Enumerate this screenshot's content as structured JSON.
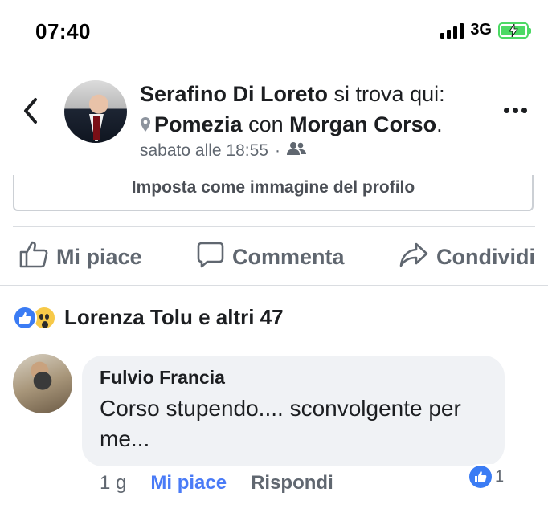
{
  "status_bar": {
    "time": "07:40",
    "network": "3G"
  },
  "post_header": {
    "author": "Serafino Di Loreto",
    "checkin_text": "si trova qui:",
    "place": "Pomezia",
    "with_text": "con",
    "tagged": "Morgan Corso",
    "period": ".",
    "timestamp": "sabato alle 18:55",
    "separator": "·"
  },
  "profile_button": {
    "label": "Imposta come immagine del profilo"
  },
  "actions": {
    "like": "Mi piace",
    "comment": "Commenta",
    "share": "Condividi"
  },
  "reactions": {
    "summary": "Lorenza Tolu e altri 47"
  },
  "comment": {
    "author": "Fulvio Francia",
    "text": "Corso stupendo.... sconvolgente per me...",
    "time": "1 g",
    "like_label": "Mi piace",
    "reply_label": "Rispondi",
    "like_count": "1"
  },
  "colors": {
    "link_blue": "#4a7bf7",
    "like_blue": "#3b7cf4",
    "battery_green": "#4cd964",
    "muted": "#606770"
  },
  "icons": [
    "back-chevron-icon",
    "location-pin-icon",
    "friends-audience-icon",
    "more-dots-icon",
    "thumbs-up-icon",
    "comment-bubble-icon",
    "share-arrow-icon",
    "like-reaction-icon",
    "wow-reaction-icon"
  ]
}
